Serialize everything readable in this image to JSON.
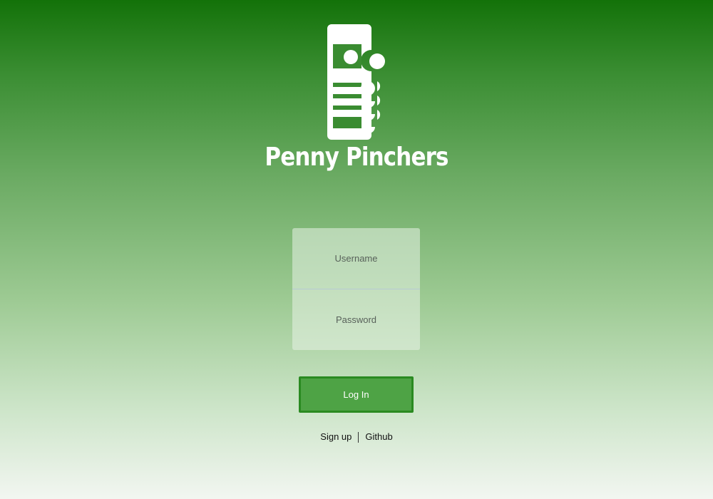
{
  "brand": {
    "name": "Penny Pinchers",
    "logo_icon": "phone-with-coins-icon"
  },
  "login_form": {
    "username_placeholder": "Username",
    "password_placeholder": "Password",
    "login_label": "Log In"
  },
  "footer_links": {
    "signup_label": "Sign up",
    "github_label": "Github"
  },
  "colors": {
    "background_top": "#137209",
    "background_bottom": "#f2f6f1",
    "button_fill": "#4ea345",
    "button_border": "#2a8a21"
  }
}
